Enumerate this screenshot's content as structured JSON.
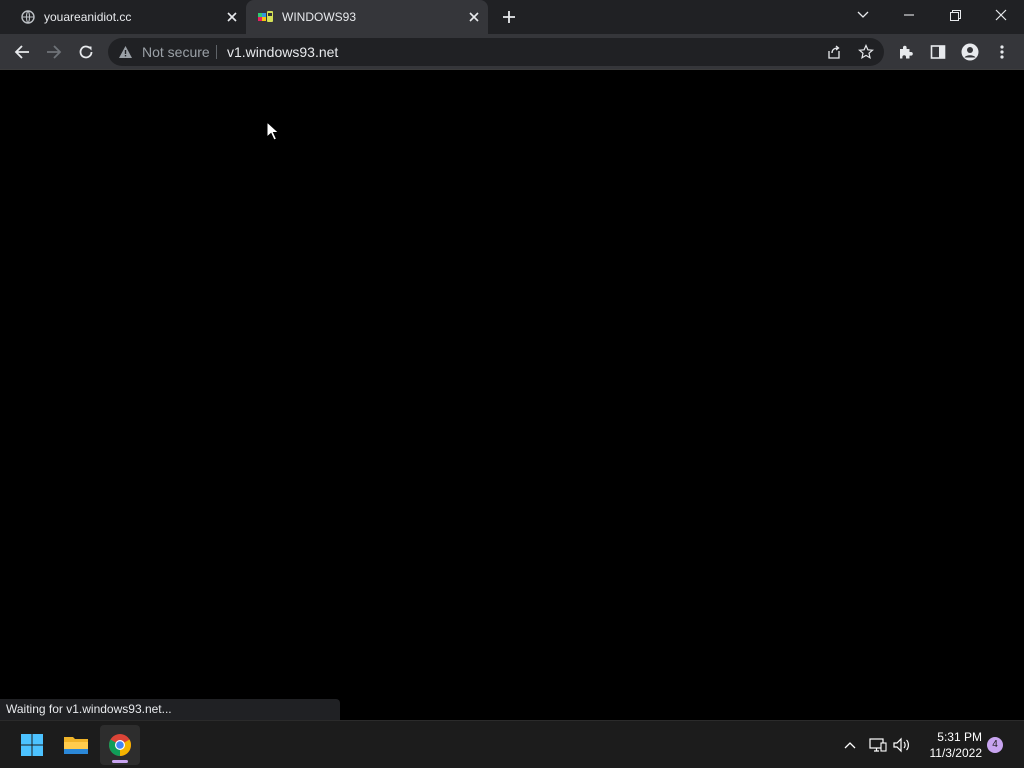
{
  "browser": {
    "tabs": [
      {
        "title": "youareanidiot.cc",
        "icon": "globe-icon",
        "active": false
      },
      {
        "title": "WINDOWS93",
        "icon": "windows93-favicon",
        "active": true
      }
    ],
    "address": {
      "security_label": "Not secure",
      "url": "v1.windows93.net"
    },
    "status_text": "Waiting for v1.windows93.net..."
  },
  "taskbar": {
    "apps": [
      "windows-start-icon",
      "file-explorer-icon",
      "chrome-icon"
    ],
    "time": "5:31 PM",
    "date": "11/3/2022",
    "notification_count": "4"
  },
  "colors": {
    "tabstrip": "#202124",
    "toolbar": "#35363a",
    "content": "#000000",
    "taskbar": "#1c1c1c",
    "accent": "#c8a4f0"
  }
}
